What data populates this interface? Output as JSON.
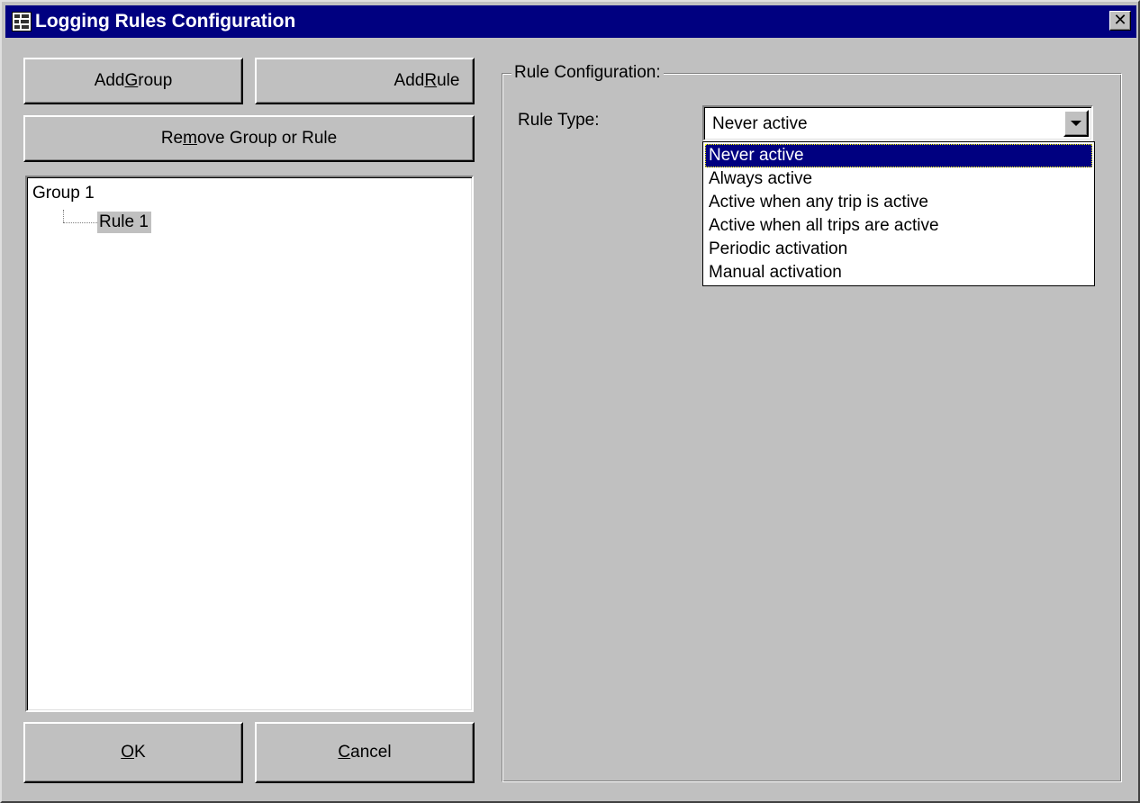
{
  "window": {
    "title": "Logging Rules Configuration",
    "close_glyph": "✕"
  },
  "buttons": {
    "add_group": {
      "pre": "Add ",
      "mnemonic": "G",
      "post": "roup"
    },
    "add_rule": {
      "pre": "Add ",
      "mnemonic": "R",
      "post": "ule"
    },
    "remove": {
      "pre": "Re",
      "mnemonic": "m",
      "post": "ove Group or Rule"
    },
    "ok": {
      "pre": "",
      "mnemonic": "O",
      "post": "K"
    },
    "cancel": {
      "pre": "",
      "mnemonic": "C",
      "post": "ancel"
    }
  },
  "tree": {
    "group": "Group 1",
    "rule": "Rule 1",
    "selected": "Rule 1"
  },
  "rule_config": {
    "legend": "Rule Configuration:",
    "rule_type_label": "Rule Type:",
    "rule_type_value": "Never active",
    "options": [
      "Never active",
      "Always active",
      "Active when any trip is active",
      "Active when all trips are active",
      "Periodic activation",
      "Manual activation"
    ],
    "highlighted_option": "Never active"
  },
  "icons": {
    "app": "app-icon",
    "close": "close-icon",
    "dropdown": "dropdown-arrow-icon"
  },
  "colors": {
    "titlebar": "#000080",
    "face": "#c0c0c0",
    "selection": "#000080"
  }
}
